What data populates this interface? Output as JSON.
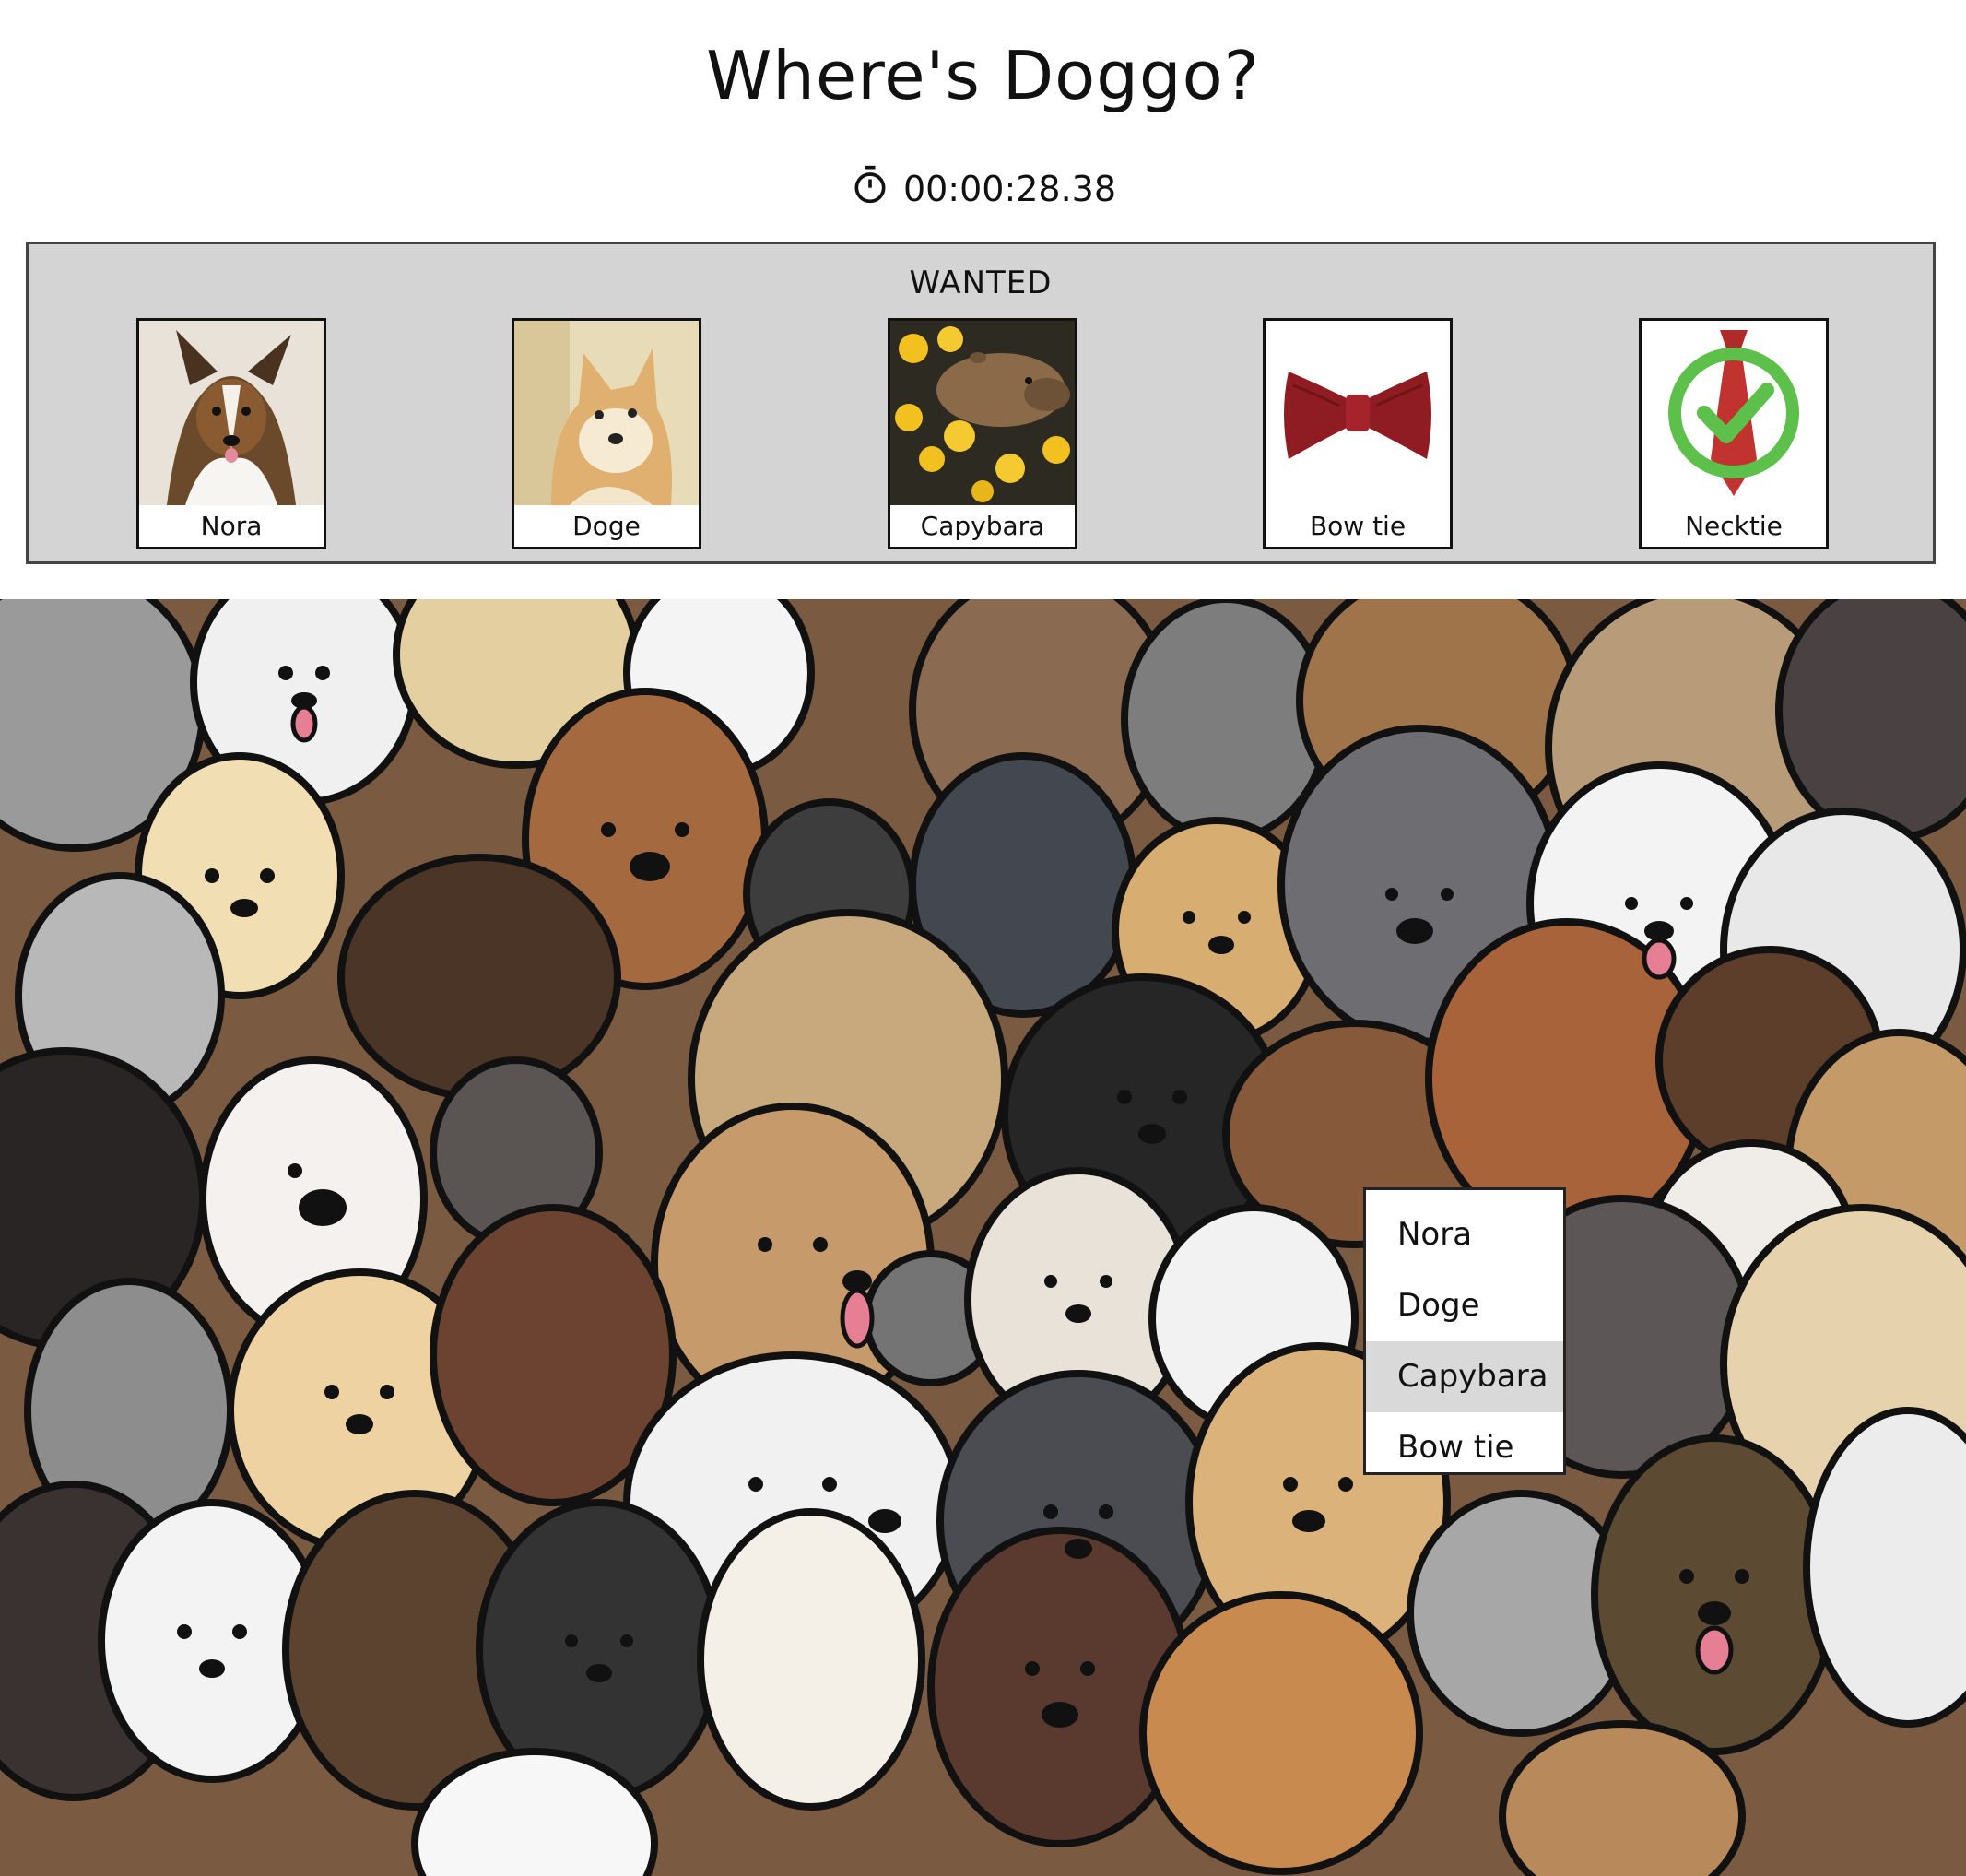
{
  "game": {
    "title": "Where's Doggo?",
    "timer": "00:00:28.38"
  },
  "wanted": {
    "heading": "WANTED",
    "items": [
      {
        "label": "Nora",
        "icon": "sheltie-dog-photo",
        "found": false
      },
      {
        "label": "Doge",
        "icon": "shiba-inu-photo",
        "found": false
      },
      {
        "label": "Capybara",
        "icon": "capybara-photo",
        "found": false
      },
      {
        "label": "Bow tie",
        "icon": "red-bow-tie",
        "found": false
      },
      {
        "label": "Necktie",
        "icon": "red-necktie",
        "found": true
      }
    ]
  },
  "menu": {
    "items": [
      {
        "label": "Nora",
        "selected": false
      },
      {
        "label": "Doge",
        "selected": false
      },
      {
        "label": "Capybara",
        "selected": true
      },
      {
        "label": "Bow tie",
        "selected": false
      }
    ]
  },
  "colors": {
    "panel_bg": "#d4d4d4",
    "found_check": "#5cc04a",
    "menu_highlight": "#d9d9d9"
  }
}
